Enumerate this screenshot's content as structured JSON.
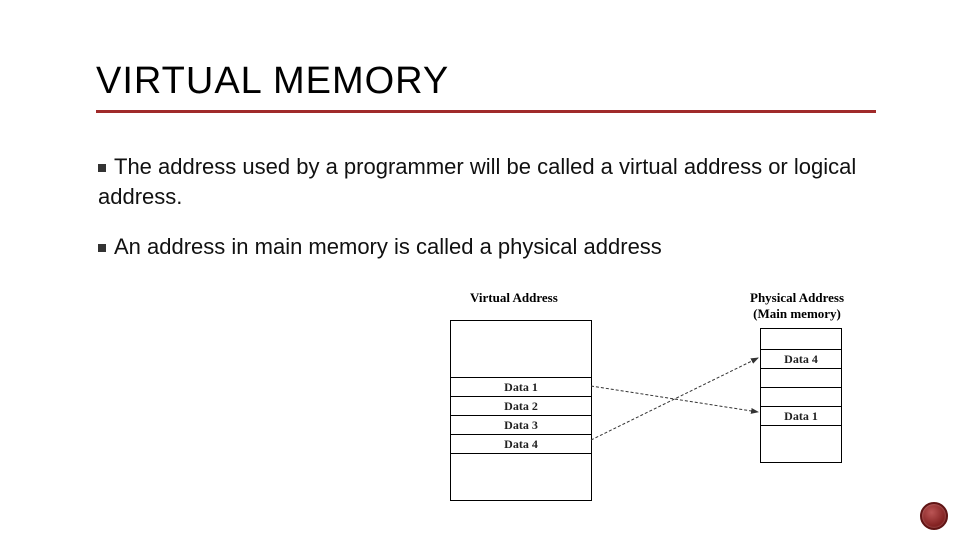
{
  "title": "VIRTUAL MEMORY",
  "bullets": [
    "The address used by a programmer will be called a virtual address or logical address.",
    "An address in main memory is called a physical address"
  ],
  "diagram": {
    "virtual_label": "Virtual Address",
    "physical_label_line1": "Physical Address",
    "physical_label_line2": "(Main memory)",
    "virtual_rows": [
      "",
      "Data 1",
      "Data 2",
      "Data 3",
      "Data 4",
      ""
    ],
    "physical_rows": [
      "",
      "Data 4",
      "",
      "",
      "Data 1",
      ""
    ]
  }
}
